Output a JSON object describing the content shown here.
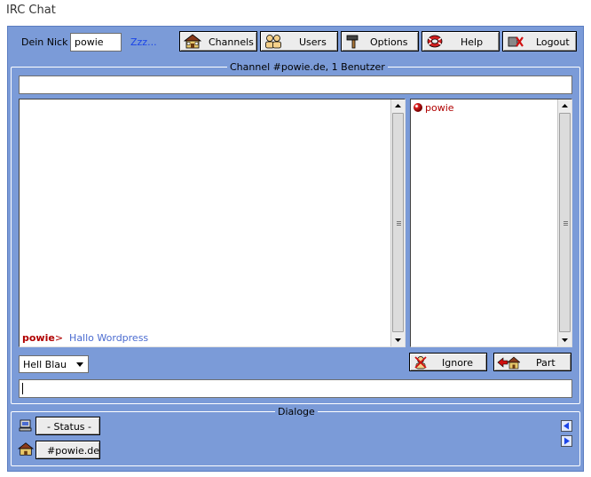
{
  "page": {
    "title": "IRC Chat"
  },
  "topbar": {
    "nick_label": "Dein Nick",
    "nick_value": "powie",
    "away_link": "Zzz...",
    "buttons": {
      "channels": "Channels",
      "users": "Users",
      "options": "Options",
      "help": "Help",
      "logout": "Logout"
    }
  },
  "channel": {
    "legend": "Channel #powie.de, 1 Benutzer",
    "topic": "",
    "messages": [
      {
        "nick": "powie",
        "separator": ">",
        "text": "Hallo Wordpress"
      }
    ],
    "users": [
      {
        "name": "powie"
      }
    ],
    "color_select": "Hell Blau",
    "ignore_label": "Ignore",
    "part_label": "Part",
    "input_value": ""
  },
  "dialogs": {
    "legend": "Dialoge",
    "status_label": "- Status -",
    "channel_label": "#powie.de"
  },
  "colors": {
    "applet_bg": "#7b9bd8",
    "nick_color": "#b00000",
    "message_color": "#4a6bd0",
    "link_color": "#1a44e8"
  }
}
